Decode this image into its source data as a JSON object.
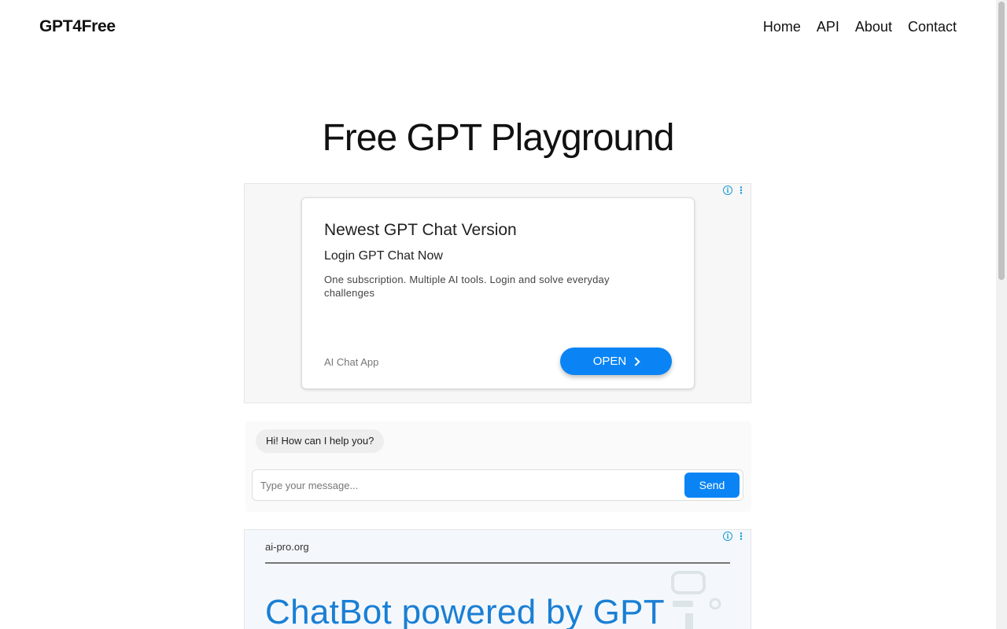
{
  "header": {
    "brand": "GPT4Free",
    "nav": [
      {
        "label": "Home"
      },
      {
        "label": "API"
      },
      {
        "label": "About"
      },
      {
        "label": "Contact"
      }
    ]
  },
  "main": {
    "title": "Free GPT Playground"
  },
  "ad_top": {
    "icons": [
      "info-icon",
      "more-vert-icon"
    ],
    "headline": "Newest GPT Chat Version",
    "subheadline": "Login GPT Chat Now",
    "description": "One subscription. Multiple AI tools. Login and solve everyday challenges",
    "source": "AI Chat App",
    "cta_label": "OPEN"
  },
  "chat": {
    "greeting": "Hi! How can I help you?",
    "input_value": "",
    "input_placeholder": "Type your message...",
    "send_label": "Send"
  },
  "ad_bottom": {
    "domain": "ai-pro.org",
    "headline": "ChatBot powered by GPT"
  },
  "colors": {
    "accent": "#0a84f5",
    "ad_link_blue": "#1a7fd4",
    "ad_icon": "#1a9ad6"
  }
}
